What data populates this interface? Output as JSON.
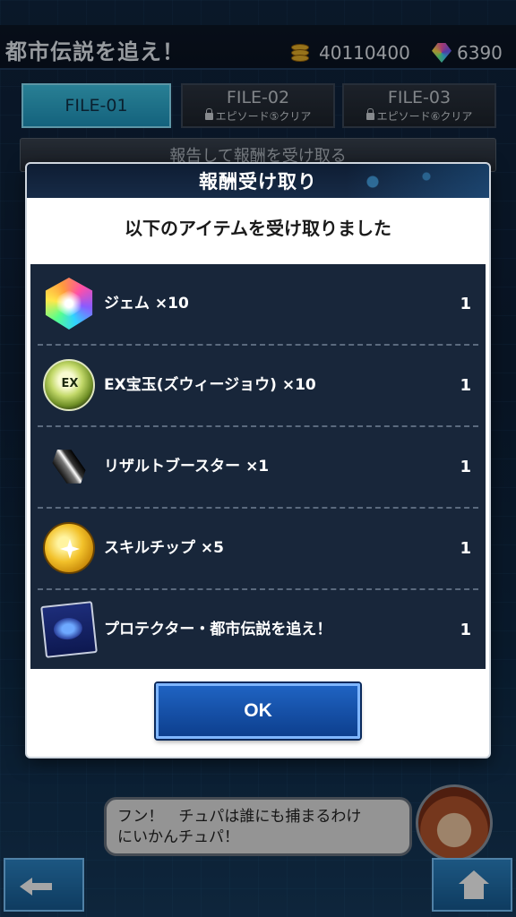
{
  "header": {
    "title": "都市伝説を追え！",
    "coins": "40110400",
    "gems": "6390"
  },
  "tabs": [
    {
      "label": "FILE-01",
      "sub": "",
      "active": true
    },
    {
      "label": "FILE-02",
      "sub": "エピソード⑤クリア",
      "active": false
    },
    {
      "label": "FILE-03",
      "sub": "エピソード⑥クリア",
      "active": false
    }
  ],
  "report_bar": {
    "label": "報告して報酬を受け取る"
  },
  "modal": {
    "title": "報酬受け取り",
    "subtitle": "以下のアイテムを受け取りました",
    "items": [
      {
        "name": "ジェム ×10",
        "qty": "1",
        "icon": "gem-icon"
      },
      {
        "name": "EX宝玉(ズウィージョウ) ×10",
        "qty": "1",
        "icon": "ex-orb-icon",
        "icon_text": "EX"
      },
      {
        "name": "リザルトブースター ×1",
        "qty": "1",
        "icon": "booster-icon"
      },
      {
        "name": "スキルチップ ×5",
        "qty": "1",
        "icon": "skill-chip-icon"
      },
      {
        "name": "プロテクター・都市伝説を追え！",
        "qty": "1",
        "icon": "card-protector-icon"
      }
    ],
    "ok_label": "OK"
  },
  "dialog": {
    "text_line1": "フン！　チュパは誰にも捕まるわけ",
    "text_line2": "にいかんチュパ！"
  },
  "colors": {
    "accent": "#1f97c0",
    "ok_button": "#1f63c2",
    "list_bg": "#18263a"
  }
}
